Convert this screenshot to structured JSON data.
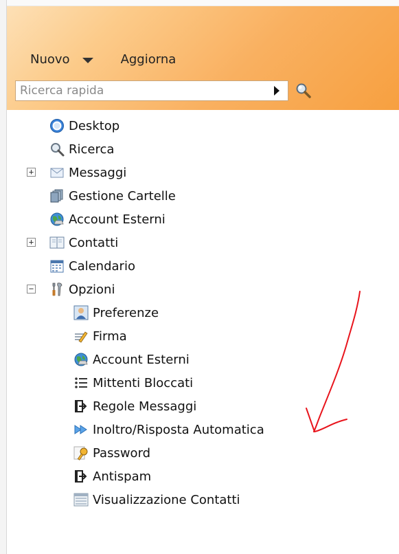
{
  "toolbar": {
    "nuovo_label": "Nuovo",
    "aggiorna_label": "Aggiorna"
  },
  "search": {
    "placeholder": "Ricerca rapida"
  },
  "tree": {
    "items": [
      {
        "label": "Desktop",
        "icon": "desktop-globe-icon"
      },
      {
        "label": "Ricerca",
        "icon": "magnifier-icon"
      },
      {
        "label": "Messaggi",
        "icon": "envelope-icon",
        "expander": "+"
      },
      {
        "label": "Gestione Cartelle",
        "icon": "folders-icon"
      },
      {
        "label": "Account Esterni",
        "icon": "globe-account-icon"
      },
      {
        "label": "Contatti",
        "icon": "address-book-icon",
        "expander": "+"
      },
      {
        "label": "Calendario",
        "icon": "calendar-icon"
      },
      {
        "label": "Opzioni",
        "icon": "tools-icon",
        "expander": "−"
      }
    ],
    "options_children": [
      {
        "label": "Preferenze",
        "icon": "user-preferences-icon"
      },
      {
        "label": "Firma",
        "icon": "signature-pen-icon"
      },
      {
        "label": "Account Esterni",
        "icon": "globe-account-icon"
      },
      {
        "label": "Mittenti Bloccati",
        "icon": "list-icon"
      },
      {
        "label": "Regole Messaggi",
        "icon": "rules-icon"
      },
      {
        "label": "Inoltro/Risposta Automatica",
        "icon": "forward-arrows-icon"
      },
      {
        "label": "Password",
        "icon": "key-icon"
      },
      {
        "label": "Antispam",
        "icon": "antispam-icon"
      },
      {
        "label": "Visualizzazione Contatti",
        "icon": "contacts-view-icon"
      }
    ]
  },
  "colors": {
    "header_gradient_start": "#fde0b6",
    "header_gradient_end": "#f7a040",
    "annotation_arrow": "#e8141c"
  }
}
